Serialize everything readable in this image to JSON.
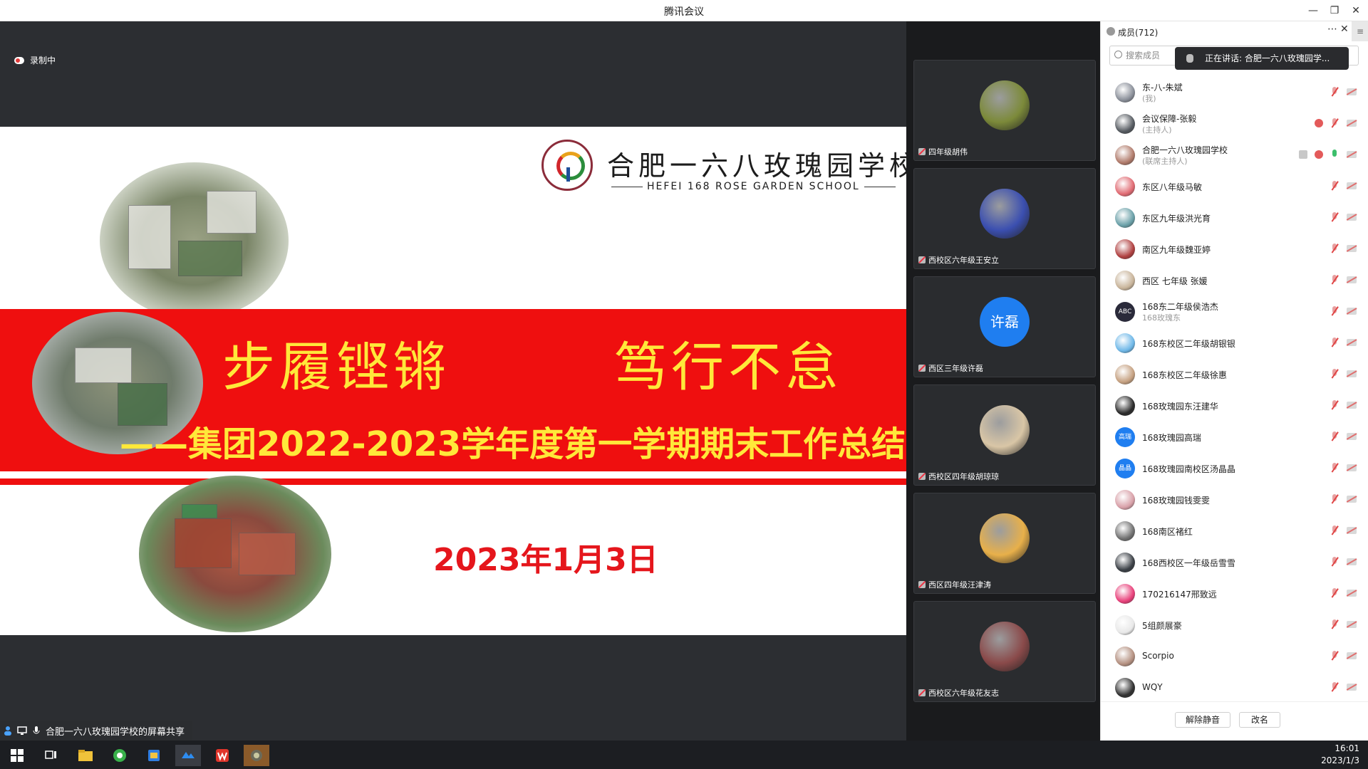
{
  "window": {
    "title": "腾讯会议"
  },
  "recording": {
    "label": "录制中"
  },
  "slide": {
    "school_cn": "合肥一六八玫瑰园学校",
    "school_en": "HEFEI 168 ROSE GARDEN SCHOOL",
    "slogan_left": "步履铿锵",
    "slogan_right": "笃行不怠",
    "subtitle": "——集团2022-2023学年度第一学期期末工作总结",
    "date": "2023年1月3日"
  },
  "share_status": {
    "label": "合肥一六八玫瑰园学校的屏幕共享"
  },
  "video_tiles": [
    {
      "name": "四年级胡伟",
      "avatar_color": "#7c8a3a"
    },
    {
      "name": "西校区六年级王安立",
      "avatar_color": "#3b4fb0"
    },
    {
      "name": "西区三年级许磊",
      "avatar_text": "许磊",
      "avatar_color": "#1f7ef0"
    },
    {
      "name": "西校区四年级胡琼琼",
      "avatar_color": "#d9c6a6"
    },
    {
      "name": "西区四年级汪津涛",
      "avatar_color": "#e8b04a"
    },
    {
      "name": "西校区六年级花友志",
      "avatar_color": "#8a4a4a"
    }
  ],
  "members": {
    "title": "成员(712)",
    "search_placeholder": "搜索成员",
    "speaking": "正在讲话: 合肥一六八玫瑰园学...",
    "rows": [
      {
        "name": "东-八-朱斌",
        "sub": "(我)",
        "avatar_color": "#8a8f99",
        "mic_on": false
      },
      {
        "name": "会议保障-张毅",
        "sub": "(主持人)",
        "avatar_color": "#555a60",
        "mic_on": false
      },
      {
        "name": "合肥一六八玫瑰园学校",
        "sub": "(联席主持人)",
        "avatar_color": "#b07a6a",
        "mic_on": true
      },
      {
        "name": "东区八年级马敏",
        "sub": "",
        "avatar_color": "#e06a72",
        "mic_on": false
      },
      {
        "name": "东区九年级洪光育",
        "sub": "",
        "avatar_color": "#6aa0a8",
        "mic_on": false
      },
      {
        "name": " 南区九年级魏亚婷",
        "sub": "",
        "avatar_color": "#b04040",
        "mic_on": false
      },
      {
        "name": " 西区 七年级 张媛",
        "sub": "",
        "avatar_color": "#c8b49a",
        "mic_on": false
      },
      {
        "name": "168东二年级侯浩杰",
        "sub": "168玫瑰东",
        "avatar_text": "ABC",
        "avatar_color": "#2a2a3a",
        "mic_on": false
      },
      {
        "name": "168东校区二年级胡银银",
        "sub": "",
        "avatar_color": "#6fb8e8",
        "mic_on": false
      },
      {
        "name": "168东校区二年级徐惠",
        "sub": "",
        "avatar_color": "#c5a080",
        "mic_on": false
      },
      {
        "name": "168玫瑰园东汪建华",
        "sub": "",
        "avatar_color": "#2a2a2a",
        "mic_on": false
      },
      {
        "name": "168玫瑰园高瑞",
        "sub": "",
        "avatar_text": "高瑞",
        "avatar_color": "#1f7ef0",
        "mic_on": false
      },
      {
        "name": "168玫瑰园南校区汤晶晶",
        "sub": "",
        "avatar_text": "晶晶",
        "avatar_color": "#1f7ef0",
        "mic_on": false
      },
      {
        "name": "168玫瑰园钱雯雯",
        "sub": "",
        "avatar_color": "#d8a0a8",
        "mic_on": false
      },
      {
        "name": "168南区褚红",
        "sub": "",
        "avatar_color": "#707070",
        "mic_on": false
      },
      {
        "name": "168西校区一年级岳雪雪",
        "sub": "",
        "avatar_color": "#3a3f45",
        "mic_on": false
      },
      {
        "name": "170216147邢致远",
        "sub": "",
        "avatar_color": "#e8407a",
        "mic_on": false
      },
      {
        "name": "5组颜展豪",
        "sub": "",
        "avatar_color": "#e8e8e8",
        "mic_on": false
      },
      {
        "name": "Scorpio",
        "sub": "",
        "avatar_color": "#b49080",
        "mic_on": false
      },
      {
        "name": "WQY",
        "sub": "",
        "avatar_color": "#303030",
        "mic_on": false
      }
    ],
    "unmute_all": "解除静音",
    "rename": "改名"
  },
  "taskbar": {
    "time": "16:01",
    "date": "2023/1/3"
  }
}
